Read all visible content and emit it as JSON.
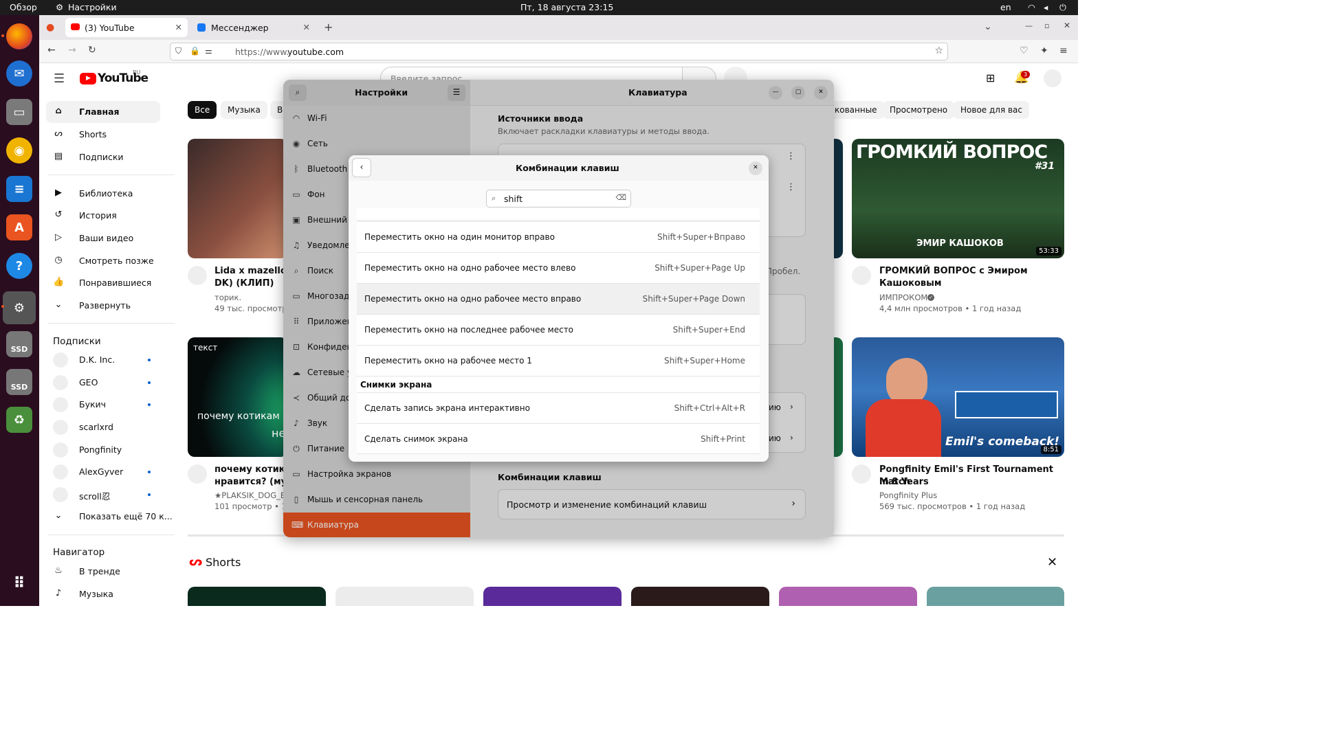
{
  "topbar": {
    "activities": "Обзор",
    "app_name": "Настройки",
    "clock": "Пт, 18 августа  23:15",
    "lang": "en"
  },
  "dock": {
    "items": [
      "firefox-icon",
      "thunderbird-icon",
      "files-icon",
      "rhythmbox-icon",
      "writer-icon",
      "app-center-icon",
      "help-icon",
      "settings-icon",
      "ssd-drive-icon",
      "ssd-drive-icon",
      "trash-icon",
      "app-grid-icon"
    ],
    "ssd_label": "SSD"
  },
  "browser": {
    "tabs": [
      {
        "label": "(3) YouTube"
      },
      {
        "label": "Мессенджер"
      }
    ],
    "url_prefix": "https://www.",
    "url_host": "youtube.com"
  },
  "youtube": {
    "logo": "YouTube",
    "logo_region": "RU",
    "search_placeholder": "Введите запрос",
    "notif_count": "3",
    "sidebar": {
      "main": [
        {
          "label": "Главная"
        },
        {
          "label": "Shorts"
        },
        {
          "label": "Подписки"
        }
      ],
      "library": [
        {
          "label": "Библиотека"
        },
        {
          "label": "История"
        },
        {
          "label": "Ваши видео"
        },
        {
          "label": "Смотреть позже"
        },
        {
          "label": "Понравившиеся"
        },
        {
          "label": "Развернуть"
        }
      ],
      "subs_title": "Подписки",
      "subs": [
        {
          "label": "D.K. Inc."
        },
        {
          "label": "GEO"
        },
        {
          "label": "Букич"
        },
        {
          "label": "scarlxrd"
        },
        {
          "label": "Pongfinity"
        },
        {
          "label": "AlexGyver"
        },
        {
          "label": "scroll忍"
        },
        {
          "label": "Показать ещё 70 к..."
        }
      ],
      "nav_title": "Навигатор",
      "nav": [
        {
          "label": "В тренде"
        },
        {
          "label": "Музыка"
        }
      ]
    },
    "chips": [
      "Все",
      "Музыка",
      "Ви",
      "кованные",
      "Просмотрено",
      "Новое для вас"
    ],
    "videos": [
      {
        "title1": "Lida x mazellovv",
        "title2": "DK) (КЛИП)",
        "channel": "торик.",
        "meta": "49 тыс. просмотр"
      },
      {
        "title1": "ГРОМКИЙ ВОПРОС с Эмиром",
        "title2": "Кашоковым",
        "channel": "ИМПРОКОМ",
        "meta": "4,4 млн просмотров • 1 год назад",
        "thumb_text": "ГРОМКИЙ ВОПРОС",
        "thumb_num": "#31",
        "thumb_sub": "ЭМИР КАШОКОВ",
        "duration": "53:33"
      },
      {
        "title1": "почему котикам",
        "title2": "нравится? (музь",
        "channel": "★PLAKSIK_DOG_BA",
        "meta": "101 просмотр • 1 д",
        "thumb_label": "текст",
        "thumb_caption": "почему котикам",
        "thumb_caption2": "не"
      },
      {
        "title1": "Pongfinity Emil's First Tournament Match",
        "title2": "in 8 Years",
        "channel": "Pongfinity Plus",
        "meta": "569 тыс. просмотров • 1 год назад",
        "thumb_text": "Emil's comeback!",
        "duration": "8:51"
      }
    ],
    "shorts_title": "Shorts"
  },
  "settings": {
    "title": "Настройки",
    "panel_title": "Клавиатура",
    "nav": [
      {
        "label": "Wi-Fi"
      },
      {
        "label": "Сеть"
      },
      {
        "label": "Bluetooth"
      },
      {
        "label": "Фон"
      },
      {
        "label": "Внешний в"
      },
      {
        "label": "Уведомлен"
      },
      {
        "label": "Поиск"
      },
      {
        "label": "Многозада"
      },
      {
        "label": "Приложен"
      },
      {
        "label": "Конфиден"
      },
      {
        "label": "Сетевые у"
      },
      {
        "label": "Общий до"
      },
      {
        "label": "Звук"
      },
      {
        "label": "Питание"
      },
      {
        "label": "Настройка экранов"
      },
      {
        "label": "Мышь и сенсорная панель"
      },
      {
        "label": "Клавиатура"
      }
    ],
    "input_sources_title": "Источники ввода",
    "input_sources_desc": "Включает раскладки клавиатуры и методы ввода.",
    "partial_text": "Пробел.",
    "partial_row": "ию",
    "shortcuts_title": "Комбинации клавиш",
    "shortcuts_row": "Просмотр и изменение комбинаций клавиш"
  },
  "dialog": {
    "title": "Комбинации клавиш",
    "search_value": "shift",
    "rows": [
      {
        "name": "Переместить окно на один монитор вправо",
        "keys": "Shift+Super+Вправо"
      },
      {
        "name": "Переместить окно на одно рабочее место влево",
        "keys": "Shift+Super+Page Up"
      },
      {
        "name": "Переместить окно на одно рабочее место вправо",
        "keys": "Shift+Super+Page Down"
      },
      {
        "name": "Переместить окно на последнее рабочее место",
        "keys": "Shift+Super+End"
      },
      {
        "name": "Переместить окно на рабочее место 1",
        "keys": "Shift+Super+Home"
      }
    ],
    "section": "Снимки экрана",
    "rows2": [
      {
        "name": "Сделать запись экрана интерактивно",
        "keys": "Shift+Ctrl+Alt+R"
      },
      {
        "name": "Сделать снимок экрана",
        "keys": "Shift+Print"
      }
    ]
  },
  "colors": {
    "accent": "#e95420",
    "yt_red": "#ff0000",
    "dock_bg": "#2a0d1f"
  }
}
